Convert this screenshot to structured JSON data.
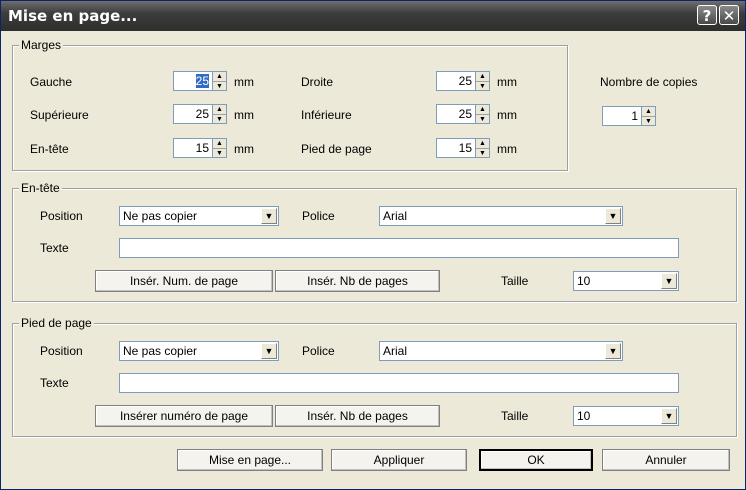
{
  "window": {
    "title": "Mise en page...",
    "help": "?",
    "close": "✕"
  },
  "margins": {
    "legend": "Marges",
    "unit": "mm",
    "left_label": "Gauche",
    "left_value": "25",
    "right_label": "Droite",
    "right_value": "25",
    "top_label": "Supérieure",
    "top_value": "25",
    "bottom_label": "Inférieure",
    "bottom_value": "25",
    "header_label": "En-tête",
    "header_value": "15",
    "footer_label": "Pied de page",
    "footer_value": "15"
  },
  "copies": {
    "label": "Nombre de copies",
    "value": "1"
  },
  "header": {
    "legend": "En-tête",
    "position_label": "Position",
    "position_value": "Ne pas copier",
    "font_label": "Police",
    "font_value": "Arial",
    "text_label": "Texte",
    "text_value": "",
    "insert_page_num": "Insér. Num. de page",
    "insert_page_count": "Insér. Nb de pages",
    "size_label": "Taille",
    "size_value": "10"
  },
  "footer": {
    "legend": "Pied de page",
    "position_label": "Position",
    "position_value": "Ne pas copier",
    "font_label": "Police",
    "font_value": "Arial",
    "text_label": "Texte",
    "text_value": "",
    "insert_page_num": "Insérer numéro de page",
    "insert_page_count": "Insér. Nb de pages",
    "size_label": "Taille",
    "size_value": "10"
  },
  "buttons": {
    "page_setup": "Mise en page...",
    "apply": "Appliquer",
    "ok": "OK",
    "cancel": "Annuler"
  },
  "icons": {
    "spin_up": "▲",
    "spin_down": "▼",
    "dropdown": "▼"
  }
}
